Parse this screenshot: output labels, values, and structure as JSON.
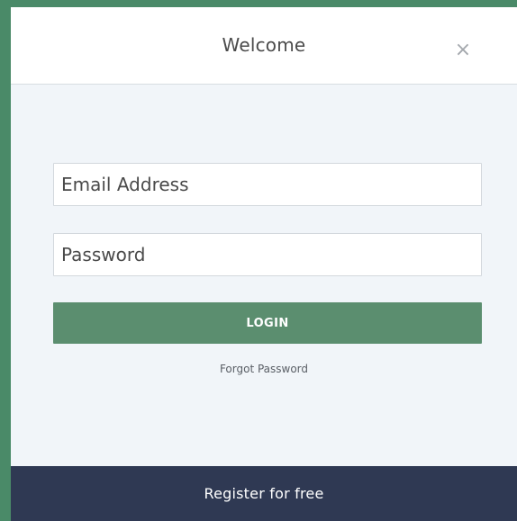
{
  "header": {
    "title": "Welcome",
    "close_icon": "close-icon",
    "close_glyph": "×"
  },
  "form": {
    "email": {
      "value": "",
      "placeholder": "Email Address"
    },
    "password": {
      "value": "",
      "placeholder": "Password"
    },
    "login_label": "LOGIN",
    "forgot_label": "Forgot Password"
  },
  "footer": {
    "register_label": "Register for free"
  },
  "colors": {
    "page_background": "#4a8a68",
    "modal_background": "#f1f5f9",
    "header_background": "#ffffff",
    "login_button": "#5b8e6f",
    "register_bar": "#2f3953"
  }
}
